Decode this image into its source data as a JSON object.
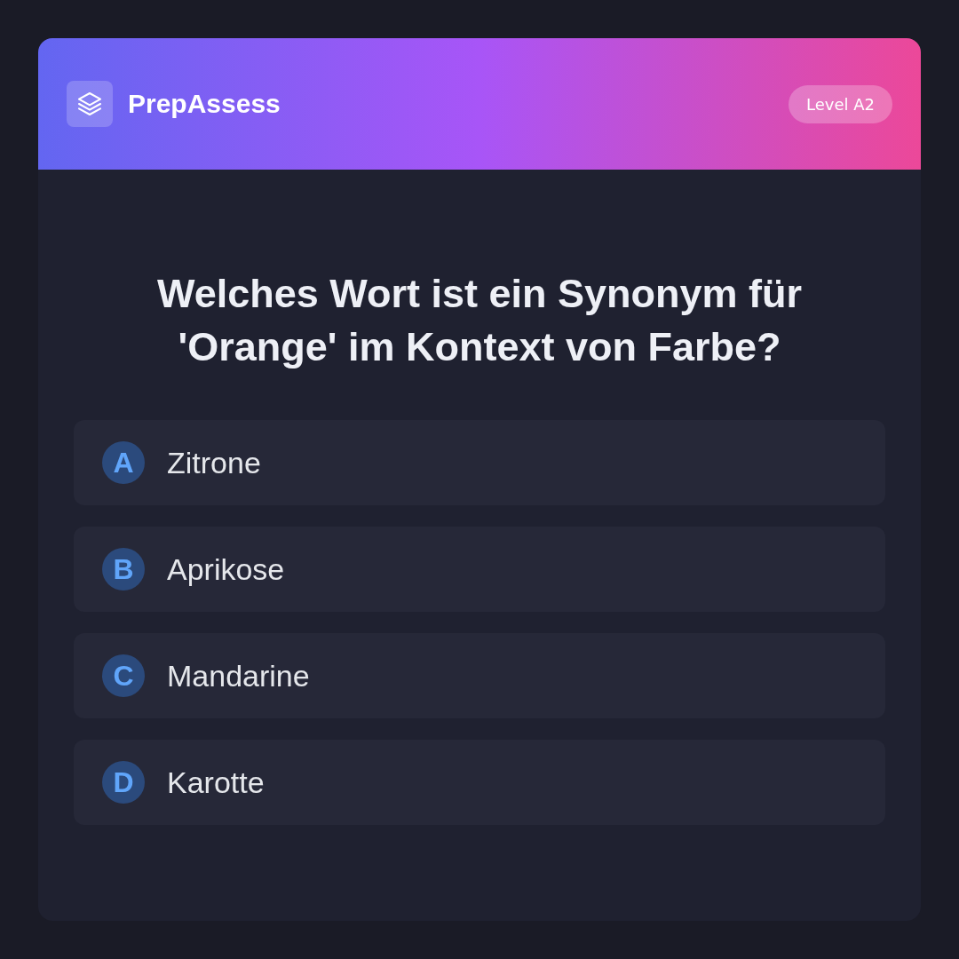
{
  "header": {
    "brand": "PrepAssess",
    "level_badge": "Level A2"
  },
  "question": "Welches Wort ist ein Synonym für 'Orange' im Kontext von Farbe?",
  "options": [
    {
      "letter": "A",
      "text": "Zitrone"
    },
    {
      "letter": "B",
      "text": "Aprikose"
    },
    {
      "letter": "C",
      "text": "Mandarine"
    },
    {
      "letter": "D",
      "text": "Karotte"
    }
  ]
}
